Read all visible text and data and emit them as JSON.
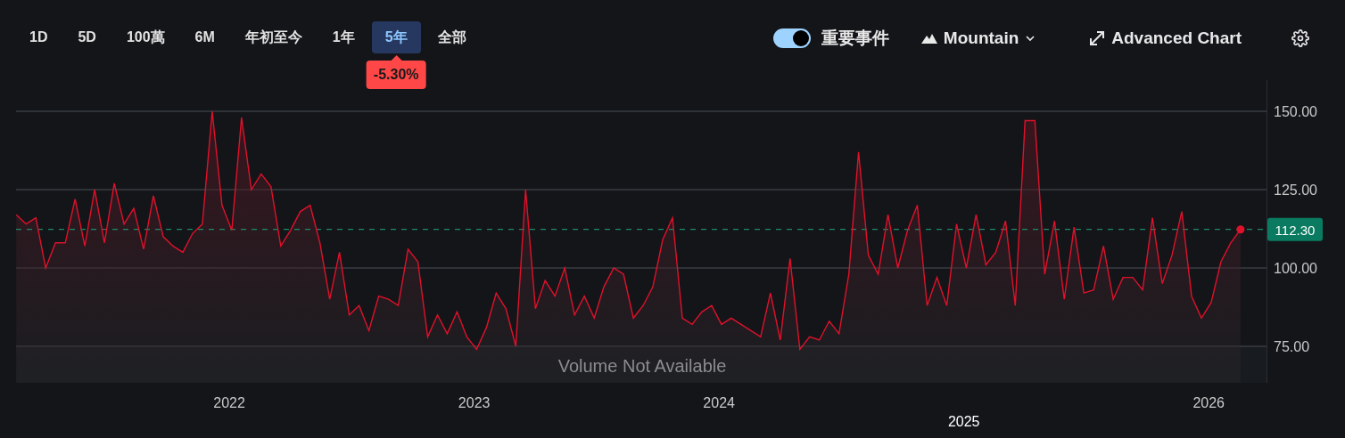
{
  "toolbar": {
    "ranges": [
      {
        "label": "1D",
        "selected": false
      },
      {
        "label": "5D",
        "selected": false
      },
      {
        "label": "100萬",
        "selected": false
      },
      {
        "label": "6M",
        "selected": false
      },
      {
        "label": "年初至今",
        "selected": false
      },
      {
        "label": "1年",
        "selected": false
      },
      {
        "label": "5年",
        "selected": true
      },
      {
        "label": "全部",
        "selected": false
      }
    ],
    "change_badge": "-5.30%",
    "events_toggle": {
      "label": "重要事件",
      "on": true
    },
    "chart_type": {
      "label": "Mountain"
    },
    "advanced_chart": {
      "label": "Advanced Chart"
    }
  },
  "chart": {
    "volume_note": "Volume Not Available",
    "crosshair_label": "2025",
    "chart_data": {
      "type": "area",
      "grid": true,
      "xlim": [
        2021.129,
        2026.236
      ],
      "ylim": [
        63.35,
        159.94
      ],
      "x": [
        2021.13,
        2021.17,
        2021.21,
        2021.25,
        2021.29,
        2021.33,
        2021.37,
        2021.41,
        2021.45,
        2021.49,
        2021.53,
        2021.57,
        2021.61,
        2021.65,
        2021.69,
        2021.73,
        2021.77,
        2021.81,
        2021.85,
        2021.89,
        2021.93,
        2021.97,
        2022.01,
        2022.05,
        2022.09,
        2022.13,
        2022.17,
        2022.21,
        2022.25,
        2022.29,
        2022.33,
        2022.37,
        2022.41,
        2022.45,
        2022.49,
        2022.53,
        2022.57,
        2022.61,
        2022.65,
        2022.69,
        2022.73,
        2022.77,
        2022.81,
        2022.85,
        2022.89,
        2022.93,
        2022.97,
        2023.01,
        2023.05,
        2023.09,
        2023.13,
        2023.17,
        2023.21,
        2023.25,
        2023.29,
        2023.33,
        2023.37,
        2023.41,
        2023.45,
        2023.49,
        2023.53,
        2023.57,
        2023.61,
        2023.65,
        2023.69,
        2023.73,
        2023.77,
        2023.81,
        2023.85,
        2023.89,
        2023.93,
        2023.97,
        2024.01,
        2024.05,
        2024.09,
        2024.13,
        2024.17,
        2024.21,
        2024.25,
        2024.29,
        2024.33,
        2024.37,
        2024.41,
        2024.45,
        2024.49,
        2024.53,
        2024.57,
        2024.61,
        2024.65,
        2024.69,
        2024.73,
        2024.77,
        2024.81,
        2024.85,
        2024.89,
        2024.93,
        2024.97,
        2025.01,
        2025.05,
        2025.09,
        2025.13,
        2025.17,
        2025.21,
        2025.25,
        2025.29,
        2025.33,
        2025.37,
        2025.41,
        2025.45,
        2025.49,
        2025.53,
        2025.57,
        2025.61,
        2025.65,
        2025.69,
        2025.73,
        2025.77,
        2025.81,
        2025.85,
        2025.89,
        2025.93,
        2025.97,
        2026.01,
        2026.05,
        2026.09,
        2026.13
      ],
      "xticks": [
        {
          "value": 2022,
          "label": "2022"
        },
        {
          "value": 2023,
          "label": "2023"
        },
        {
          "value": 2024,
          "label": "2024"
        },
        {
          "value": 2026,
          "label": "2026"
        }
      ],
      "yticks": [
        {
          "value": 75,
          "label": "75.00"
        },
        {
          "value": 100,
          "label": "100.00"
        },
        {
          "value": 125,
          "label": "125.00"
        },
        {
          "value": 150,
          "label": "150.00"
        }
      ],
      "ref_lines": [
        {
          "axis": "y",
          "value": 112.3,
          "label": "112.30",
          "color": "#1f8a6a"
        }
      ],
      "series": [
        {
          "color": "#e0112b",
          "values": [
            117,
            114,
            116,
            100,
            108,
            108,
            122,
            107,
            125,
            108,
            127,
            114,
            119,
            106,
            123,
            110,
            107,
            105,
            111,
            114,
            150,
            120,
            112,
            148,
            125,
            130,
            126,
            107,
            112,
            118,
            120,
            108,
            90,
            105,
            85,
            88,
            80,
            91,
            90,
            88,
            106,
            102,
            78,
            85,
            79,
            86,
            78,
            74,
            81,
            92,
            87,
            75,
            125,
            87,
            96,
            91,
            100,
            85,
            91,
            84,
            94,
            100,
            98,
            84,
            88,
            94,
            109,
            116,
            84,
            82,
            86,
            88,
            82,
            84,
            82,
            80,
            78,
            92,
            77,
            103,
            74,
            78,
            77,
            83,
            79,
            98,
            137,
            104,
            98,
            117,
            100,
            112,
            120,
            88,
            97,
            88,
            114,
            100,
            117,
            101,
            105,
            115,
            88,
            147,
            147,
            98,
            115,
            90,
            113,
            92,
            93,
            107,
            90,
            97,
            97,
            93,
            116,
            95,
            104,
            118,
            91,
            84,
            89,
            102,
            108,
            112.3
          ]
        }
      ]
    }
  }
}
